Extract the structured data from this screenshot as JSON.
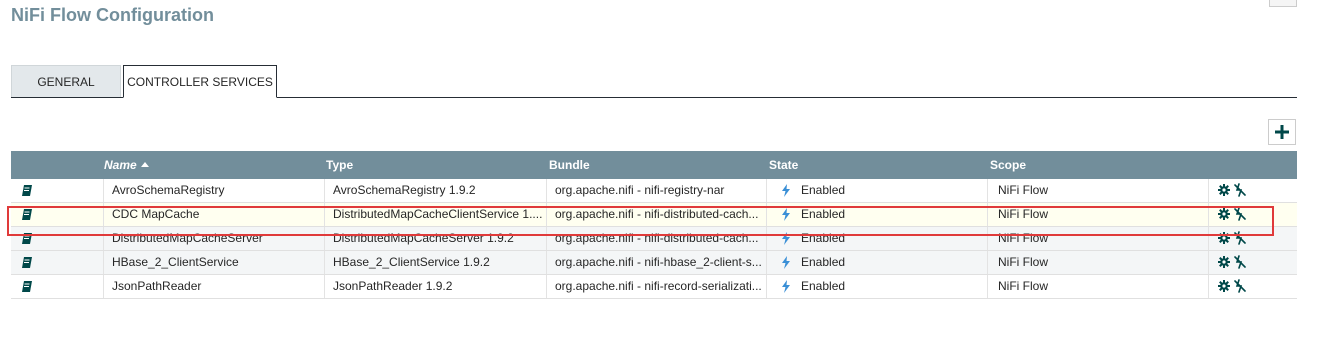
{
  "page": {
    "title": "NiFi Flow Configuration"
  },
  "tabs": [
    {
      "label": "GENERAL",
      "active": false
    },
    {
      "label": "CONTROLLER SERVICES",
      "active": true
    }
  ],
  "toolbar": {
    "add_icon": "plus-icon"
  },
  "table": {
    "columns": {
      "name": "Name",
      "type": "Type",
      "bundle": "Bundle",
      "state": "State",
      "scope": "Scope"
    },
    "sort": {
      "column": "Name",
      "direction": "ascending"
    },
    "rows": [
      {
        "name": "AvroSchemaRegistry",
        "type": "AvroSchemaRegistry 1.9.2",
        "bundle": "org.apache.nifi - nifi-registry-nar",
        "state": "Enabled",
        "scope": "NiFi Flow"
      },
      {
        "name": "CDC MapCache",
        "type": "DistributedMapCacheClientService 1....",
        "bundle": "org.apache.nifi - nifi-distributed-cach...",
        "state": "Enabled",
        "scope": "NiFi Flow"
      },
      {
        "name": "DistributedMapCacheServer",
        "type": "DistributedMapCacheServer 1.9.2",
        "bundle": "org.apache.nifi - nifi-distributed-cach...",
        "state": "Enabled",
        "scope": "NiFi Flow"
      },
      {
        "name": "HBase_2_ClientService",
        "type": "HBase_2_ClientService 1.9.2",
        "bundle": "org.apache.nifi - nifi-hbase_2-client-s...",
        "state": "Enabled",
        "scope": "NiFi Flow"
      },
      {
        "name": "JsonPathReader",
        "type": "JsonPathReader 1.9.2",
        "bundle": "org.apache.nifi - nifi-record-serializati...",
        "state": "Enabled",
        "scope": "NiFi Flow"
      }
    ]
  },
  "colors": {
    "header": "#728e9b",
    "title": "#728e9b",
    "enabled_bolt": "#3a8fd6",
    "highlight": "#e03a3a"
  }
}
